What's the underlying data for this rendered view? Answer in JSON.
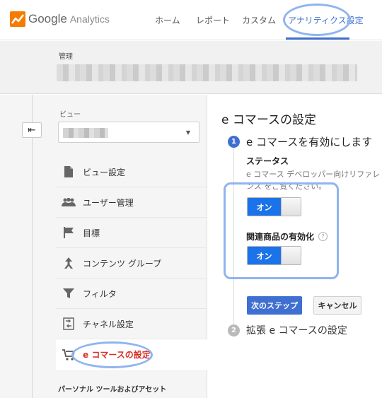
{
  "header": {
    "logo_google": "Google",
    "logo_analytics": "Analytics",
    "nav": [
      {
        "label": "ホーム"
      },
      {
        "label": "レポート"
      },
      {
        "label": "カスタム"
      },
      {
        "label": "アナリティクス設定",
        "active": true
      }
    ],
    "accent_color": "#3f6fd1"
  },
  "account": {
    "label": "管理"
  },
  "sidebar": {
    "view_label": "ビュー",
    "items": [
      {
        "label": "ビュー設定",
        "icon": "document-icon"
      },
      {
        "label": "ユーザー管理",
        "icon": "people-icon"
      },
      {
        "label": "目標",
        "icon": "flag-icon"
      },
      {
        "label": "コンテンツ グループ",
        "icon": "content-group-icon"
      },
      {
        "label": "フィルタ",
        "icon": "filter-icon"
      },
      {
        "label": "チャネル設定",
        "icon": "channel-icon"
      },
      {
        "label": "e コマースの設定",
        "icon": "cart-icon",
        "active": true
      }
    ],
    "section_label": "パーソナル ツールおよびアセット"
  },
  "main": {
    "title": "e コマースの設定",
    "step1": {
      "number": "1",
      "title": "e コマースを有効にします",
      "status_label": "ステータス",
      "status_desc": "e コマース デベロッパー向けリファレンス をご覧ください。",
      "toggle1_on": "オン",
      "related_label": "関連商品の有効化",
      "help": "?",
      "toggle2_on": "オン",
      "next_button": "次のステップ",
      "cancel_button": "キャンセル"
    },
    "step2": {
      "number": "2",
      "title": "拡張 e コマースの設定"
    }
  }
}
